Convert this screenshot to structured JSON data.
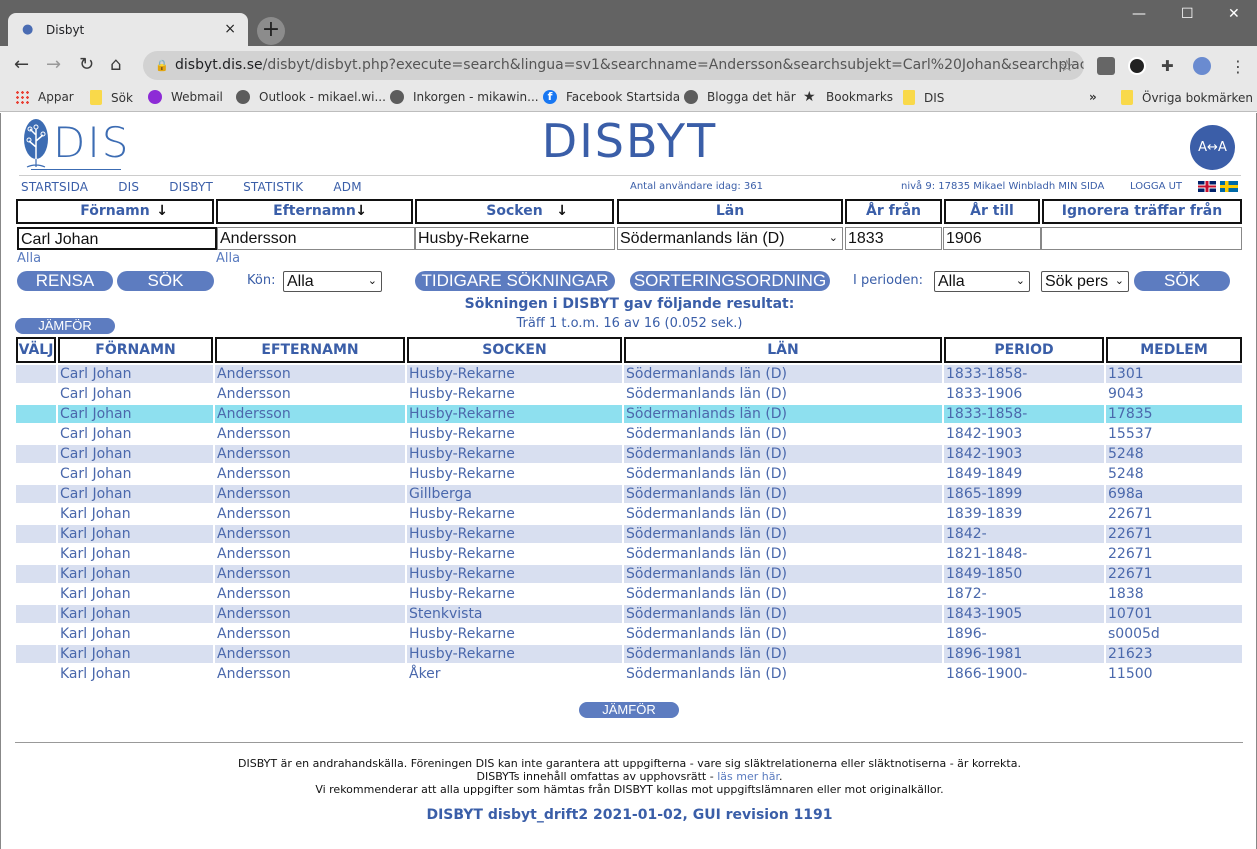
{
  "browser": {
    "tab_title": "Disbyt",
    "tab_close": "×",
    "new_tab": "+",
    "url_host": "disbyt.dis.se",
    "url_path": "/disbyt/disbyt.php?execute=search&lingua=sv1&searchname=Andersson&searchsubjekt=Carl%20Johan&searchplace=Husby-...",
    "window_controls": {
      "minimize": "—",
      "maximize": "☐",
      "close": "✕"
    },
    "bookmarks": [
      {
        "label": "Appar",
        "icon": "apps-icon"
      },
      {
        "label": "Sök",
        "icon": "folder-icon"
      },
      {
        "label": "Webmail",
        "icon": "webmail-icon"
      },
      {
        "label": "Outlook - mikael.wi...",
        "icon": "globe-icon"
      },
      {
        "label": "Inkorgen - mikawin...",
        "icon": "globe-icon"
      },
      {
        "label": "Facebook Startsida",
        "icon": "facebook-icon"
      },
      {
        "label": "Blogga det här",
        "icon": "globe-icon"
      },
      {
        "label": "Bookmarks",
        "icon": "star-icon"
      },
      {
        "label": "DIS",
        "icon": "folder-icon"
      }
    ],
    "bookmarks_overflow": "»",
    "other_bookmarks": "Övriga bokmärken"
  },
  "header": {
    "logo_text": "DIS",
    "brand": "DISBYT",
    "swap_icon": "A↔A",
    "nav": [
      "STARTSIDA",
      "DIS",
      "DISBYT",
      "STATISTIK",
      "ADM"
    ],
    "users_today": "Antal användare idag: 361",
    "user_info": "nivå 9: 17835 Mikael Winbladh MIN SIDA",
    "logout": "LOGGA UT"
  },
  "search": {
    "headers": {
      "firstname": "Förnamn",
      "lastname": "Efternamn",
      "parish": "Socken",
      "county": "Län",
      "year_from": "År från",
      "year_to": "År till",
      "ignore": "Ignorera träffar från"
    },
    "sort_arrow": "🡣",
    "values": {
      "firstname": "Carl Johan",
      "lastname": "Andersson",
      "parish": "Husby-Rekarne",
      "county": "Södermanlands län (D)",
      "year_from": "1833",
      "year_to": "1906",
      "ignore": ""
    },
    "alla_first": "Alla",
    "alla_last": "Alla",
    "buttons": {
      "clear": "RENSA",
      "search": "SÖK",
      "previous": "TIDIGARE SÖKNINGAR",
      "sort": "SORTERINGSORDNING",
      "search2": "SÖK"
    },
    "gender_label": "Kön:",
    "gender_value": "Alla",
    "period_label": "I perioden:",
    "period_value": "Alla",
    "mode_value": "Sök pers"
  },
  "results": {
    "title": "Sökningen i DISBYT gav följande resultat:",
    "subtitle": "Träff 1 t.o.m. 16 av 16 (0.052 sek.)",
    "compare_label": "JÄMFÖR",
    "columns": [
      "VÄLJ",
      "FÖRNAMN",
      "EFTERNAMN",
      "SOCKEN",
      "LÄN",
      "PERIOD",
      "MEDLEM"
    ],
    "rows": [
      {
        "first": "Carl Johan",
        "last": "Andersson",
        "parish": "Husby-Rekarne",
        "county": "Södermanlands län (D)",
        "period": "1833-1858-",
        "member": "1301"
      },
      {
        "first": "Carl Johan",
        "last": "Andersson",
        "parish": "Husby-Rekarne",
        "county": "Södermanlands län (D)",
        "period": "1833-1906",
        "member": "9043"
      },
      {
        "first": "Carl Johan",
        "last": "Andersson",
        "parish": "Husby-Rekarne",
        "county": "Södermanlands län (D)",
        "period": "1833-1858-",
        "member": "17835",
        "highlight": true
      },
      {
        "first": "Carl Johan",
        "last": "Andersson",
        "parish": "Husby-Rekarne",
        "county": "Södermanlands län (D)",
        "period": "1842-1903",
        "member": "15537"
      },
      {
        "first": "Carl Johan",
        "last": "Andersson",
        "parish": "Husby-Rekarne",
        "county": "Södermanlands län (D)",
        "period": "1842-1903",
        "member": "5248"
      },
      {
        "first": "Carl Johan",
        "last": "Andersson",
        "parish": "Husby-Rekarne",
        "county": "Södermanlands län (D)",
        "period": "1849-1849",
        "member": "5248"
      },
      {
        "first": "Carl Johan",
        "last": "Andersson",
        "parish": "Gillberga",
        "county": "Södermanlands län (D)",
        "period": "1865-1899",
        "member": "698a"
      },
      {
        "first": "Karl Johan",
        "last": "Andersson",
        "parish": "Husby-Rekarne",
        "county": "Södermanlands län (D)",
        "period": "1839-1839",
        "member": "22671"
      },
      {
        "first": "Karl Johan",
        "last": "Andersson",
        "parish": "Husby-Rekarne",
        "county": "Södermanlands län (D)",
        "period": "1842-",
        "member": "22671"
      },
      {
        "first": "Karl Johan",
        "last": "Andersson",
        "parish": "Husby-Rekarne",
        "county": "Södermanlands län (D)",
        "period": "1821-1848-",
        "member": "22671"
      },
      {
        "first": "Karl Johan",
        "last": "Andersson",
        "parish": "Husby-Rekarne",
        "county": "Södermanlands län (D)",
        "period": "1849-1850",
        "member": "22671"
      },
      {
        "first": "Karl Johan",
        "last": "Andersson",
        "parish": "Husby-Rekarne",
        "county": "Södermanlands län (D)",
        "period": "1872-",
        "member": "1838"
      },
      {
        "first": "Karl Johan",
        "last": "Andersson",
        "parish": "Stenkvista",
        "county": "Södermanlands län (D)",
        "period": "1843-1905",
        "member": "10701"
      },
      {
        "first": "Karl Johan",
        "last": "Andersson",
        "parish": "Husby-Rekarne",
        "county": "Södermanlands län (D)",
        "period": "1896-",
        "member": "s0005d"
      },
      {
        "first": "Karl Johan",
        "last": "Andersson",
        "parish": "Husby-Rekarne",
        "county": "Södermanlands län (D)",
        "period": "1896-1981",
        "member": "21623"
      },
      {
        "first": "Karl Johan",
        "last": "Andersson",
        "parish": "Åker",
        "county": "Södermanlands län (D)",
        "period": "1866-1900-",
        "member": "11500"
      }
    ]
  },
  "footer": {
    "line1": "DISBYT är en andrahandskälla. Föreningen DIS kan inte garantera att uppgifterna - vare sig släktrelationerna eller släktnotiserna - är korrekta.",
    "line2_prefix": "DISBYTs innehåll omfattas av upphovsrätt - ",
    "line2_link": "läs mer här",
    "line2_suffix": ".",
    "line3": "Vi rekommenderar att alla uppgifter som hämtas från DISBYT kollas mot uppgiftslämnaren eller mot originalkällor.",
    "version": "DISBYT disbyt_drift2 2021-01-02, GUI revision 1191"
  },
  "colors": {
    "brand_blue": "#3a5ea8",
    "button_blue": "#5d7cc0",
    "row_alt": "#d8dff0",
    "row_highlight": "#8ee0ef"
  }
}
